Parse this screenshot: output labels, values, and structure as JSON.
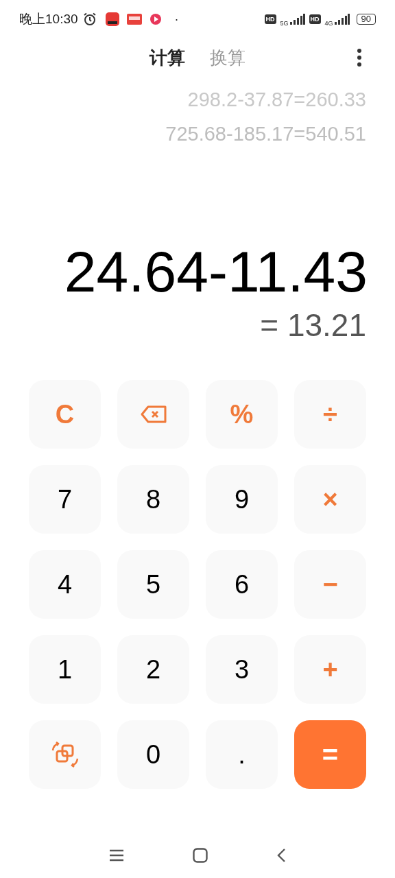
{
  "status_bar": {
    "time": "晚上10:30",
    "dot": "·",
    "sim": [
      {
        "badge": "HD",
        "network": "5G"
      },
      {
        "badge": "HD",
        "network": "4G"
      }
    ],
    "battery": "90"
  },
  "tabs": [
    {
      "label": "计算",
      "selected": true
    },
    {
      "label": "换算",
      "selected": false
    }
  ],
  "history": [
    "298.2-37.87=260.33",
    "725.68-185.17=540.51"
  ],
  "expression": "24.64-11.43",
  "result": "= 13.21",
  "keys": [
    {
      "kind": "op",
      "label": "C"
    },
    {
      "kind": "backspace"
    },
    {
      "kind": "op",
      "label": "%"
    },
    {
      "kind": "op",
      "label": "÷"
    },
    {
      "kind": "digit",
      "label": "7"
    },
    {
      "kind": "digit",
      "label": "8"
    },
    {
      "kind": "digit",
      "label": "9"
    },
    {
      "kind": "op",
      "label": "×"
    },
    {
      "kind": "digit",
      "label": "4"
    },
    {
      "kind": "digit",
      "label": "5"
    },
    {
      "kind": "digit",
      "label": "6"
    },
    {
      "kind": "op",
      "label": "−"
    },
    {
      "kind": "digit",
      "label": "1"
    },
    {
      "kind": "digit",
      "label": "2"
    },
    {
      "kind": "digit",
      "label": "3"
    },
    {
      "kind": "op",
      "label": "+"
    },
    {
      "kind": "convert"
    },
    {
      "kind": "digit",
      "label": "0"
    },
    {
      "kind": "digit",
      "label": "."
    },
    {
      "kind": "equals",
      "label": "="
    }
  ]
}
